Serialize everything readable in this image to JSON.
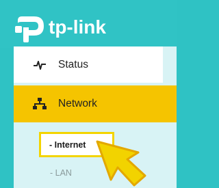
{
  "brand": {
    "name": "tp-link",
    "icon": "tp-link-logo-icon"
  },
  "nav": {
    "items": [
      {
        "label": "Status",
        "icon": "status-pulse-icon",
        "active": false
      },
      {
        "label": "Network",
        "icon": "network-topology-icon",
        "active": true
      }
    ],
    "network_sub": [
      {
        "label": "- Internet",
        "highlighted": true
      },
      {
        "label": "- LAN",
        "highlighted": false
      }
    ]
  },
  "colors": {
    "header": "#30c3c5",
    "sidebar_bg": "#d8f3f5",
    "active_item": "#f5c400",
    "highlight_border": "#f3d400",
    "pointer_arrow": "#f2d300"
  },
  "overlay": {
    "pointer_icon": "pointer-arrow-icon"
  }
}
